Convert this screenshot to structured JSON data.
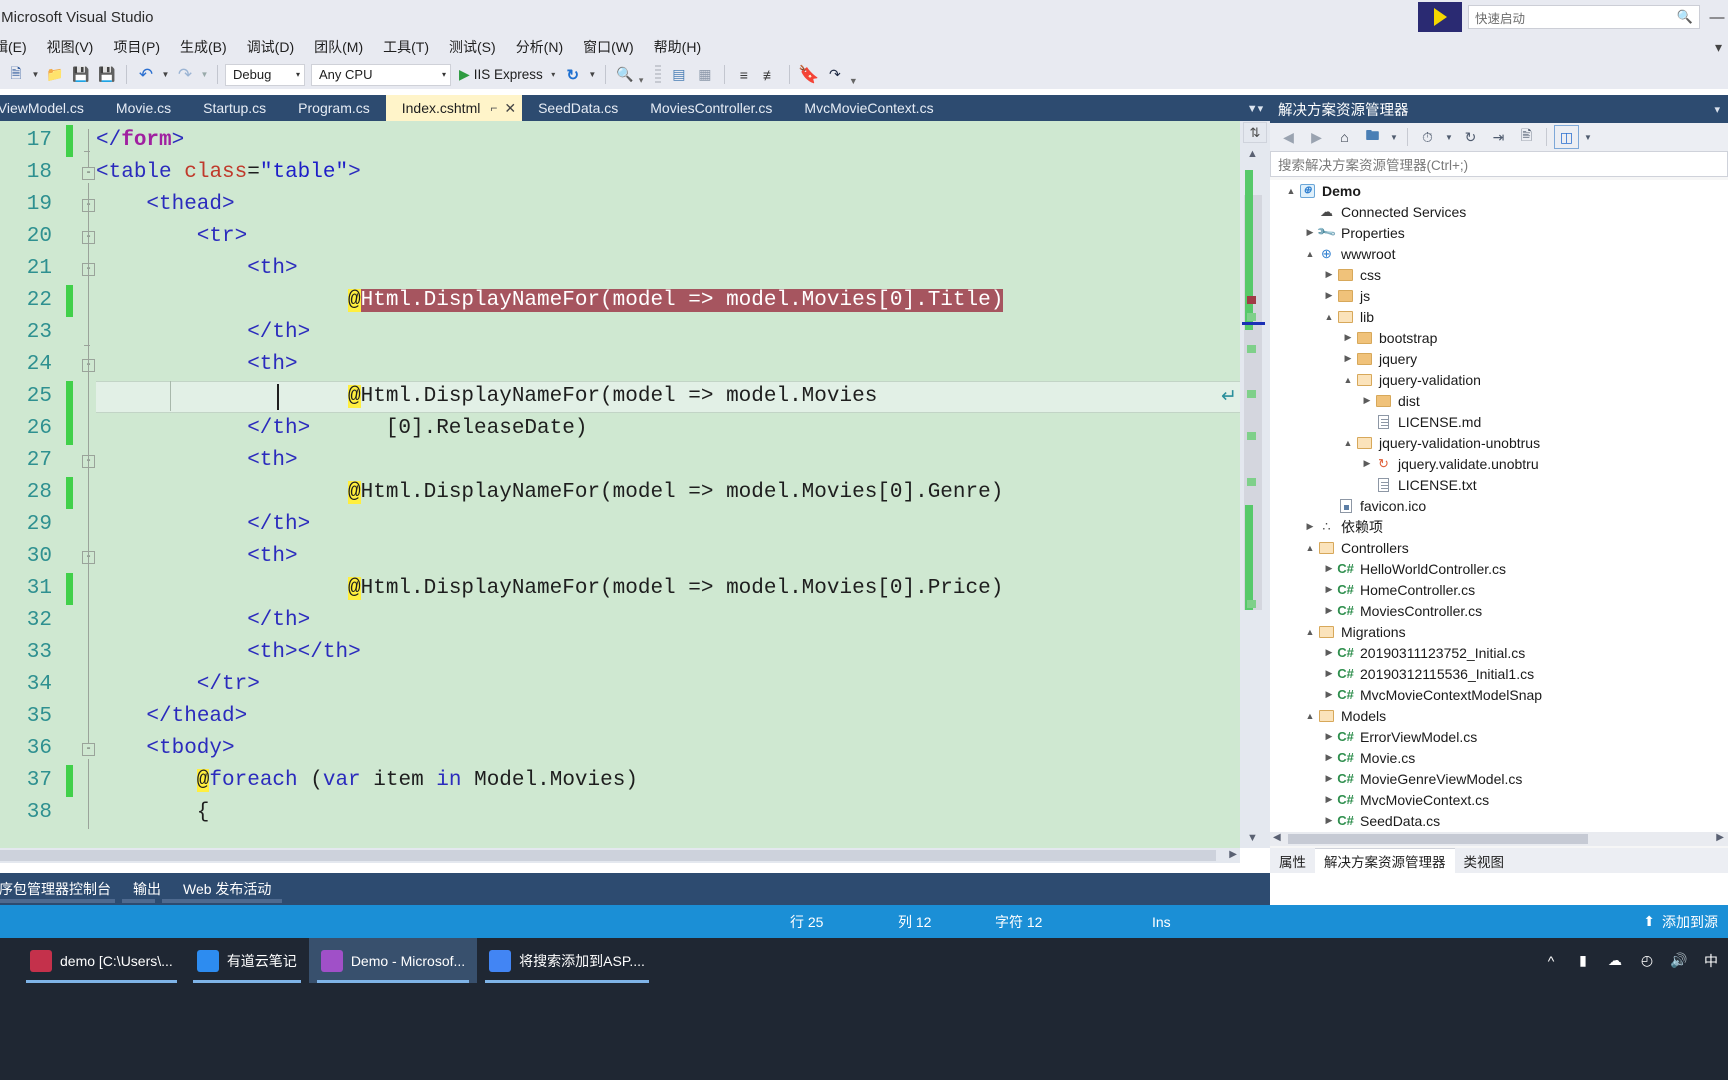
{
  "titlebar": {
    "title": "- Microsoft Visual Studio",
    "quick_launch_placeholder": "快速启动",
    "quick_launch_icon": "magnifier-icon",
    "flag_icon": "vs-flag-icon",
    "minimize": "—"
  },
  "menu": {
    "items": [
      "辑(E)",
      "视图(V)",
      "项目(P)",
      "生成(B)",
      "调试(D)",
      "团队(M)",
      "工具(T)",
      "测试(S)",
      "分析(N)",
      "窗口(W)",
      "帮助(H)"
    ],
    "overflow": "▾"
  },
  "toolbar": {
    "new_project_icon": "new-project-icon",
    "open_icon": "open-folder-icon",
    "save_icon": "save-icon",
    "save_all_icon": "save-all-icon",
    "undo_icon": "undo-icon",
    "redo_icon": "redo-icon",
    "config": {
      "value": "Debug",
      "caret": "▾"
    },
    "platform": {
      "value": "Any CPU",
      "caret": "▾"
    },
    "run": {
      "play": "▶",
      "label": "IIS Express",
      "caret": "▾"
    },
    "refresh_icon": "refresh-icon",
    "find_icon": "find-icon",
    "comment_icon": "comment-icon",
    "uncomment_icon": "uncomment-icon",
    "indent_icon": "indent-icon",
    "outdent_icon": "outdent-icon",
    "bookmark_icon": "bookmark-icon",
    "next_bookmark_icon": "next-bookmark-icon",
    "overflow_caret": "▾"
  },
  "tabs": {
    "items": [
      {
        "label": "eViewModel.cs",
        "active": false
      },
      {
        "label": "Movie.cs",
        "active": false
      },
      {
        "label": "Startup.cs",
        "active": false
      },
      {
        "label": "Program.cs",
        "active": false
      },
      {
        "label": "Index.cshtml",
        "active": true,
        "pin": "⌐",
        "close": "✕"
      },
      {
        "label": "SeedData.cs",
        "active": false
      },
      {
        "label": "MoviesController.cs",
        "active": false
      },
      {
        "label": "MvcMovieContext.cs",
        "active": false
      }
    ],
    "overflow_icon": "tab-overflow-icon"
  },
  "editor": {
    "lines": [
      {
        "num": "17",
        "changed": true,
        "fold": null,
        "indent": 0
      },
      {
        "num": "18",
        "changed": false,
        "fold": "-",
        "indent": 0
      },
      {
        "num": "19",
        "changed": false,
        "fold": "-",
        "indent": 1
      },
      {
        "num": "20",
        "changed": false,
        "fold": "-",
        "indent": 1
      },
      {
        "num": "21",
        "changed": false,
        "fold": "-",
        "indent": 1
      },
      {
        "num": "22",
        "changed": true,
        "fold": null,
        "indent": 1
      },
      {
        "num": "23",
        "changed": false,
        "fold": null,
        "indent": 1
      },
      {
        "num": "24",
        "changed": false,
        "fold": "-",
        "indent": 1
      },
      {
        "num": "25",
        "changed": true,
        "fold": null,
        "indent": 1
      },
      {
        "num": "26",
        "changed": true,
        "fold": null,
        "indent": 1
      },
      {
        "num": "27",
        "changed": false,
        "fold": "-",
        "indent": 1
      },
      {
        "num": "28",
        "changed": true,
        "fold": null,
        "indent": 1
      },
      {
        "num": "29",
        "changed": false,
        "fold": null,
        "indent": 1
      },
      {
        "num": "30",
        "changed": false,
        "fold": "-",
        "indent": 1
      },
      {
        "num": "31",
        "changed": true,
        "fold": null,
        "indent": 1
      },
      {
        "num": "32",
        "changed": false,
        "fold": null,
        "indent": 1
      },
      {
        "num": "33",
        "changed": false,
        "fold": null,
        "indent": 1
      },
      {
        "num": "34",
        "changed": false,
        "fold": null,
        "indent": 1
      },
      {
        "num": "35",
        "changed": false,
        "fold": null,
        "indent": 0
      },
      {
        "num": "36",
        "changed": false,
        "fold": "-",
        "indent": 0
      },
      {
        "num": "37",
        "changed": true,
        "fold": null,
        "indent": 1
      },
      {
        "num": "38",
        "changed": false,
        "fold": null,
        "indent": 1
      }
    ],
    "code_text": {
      "l17": "</form>",
      "l18": "<table class=\"table\">",
      "l19": "<thead>",
      "l20": "<tr>",
      "l21": "<th>",
      "l22": "@Html.DisplayNameFor(model => model.Movies[0].Title)",
      "l23": "</th>",
      "l24": "<th>",
      "l25a": "@Html.DisplayNameFor(model => model.Movies",
      "l25b": "[0].ReleaseDate)",
      "l26": "</th>",
      "l27": "<th>",
      "l28": "@Html.DisplayNameFor(model => model.Movies[0].Genre)",
      "l29": "</th>",
      "l30": "<th>",
      "l31": "@Html.DisplayNameFor(model => model.Movies[0].Price)",
      "l32": "</th>",
      "l33": "<th></th>",
      "l34": "</tr>",
      "l35": "</thead>",
      "l36": "<tbody>",
      "l37": "@foreach (var item in Model.Movies)",
      "l38": "{"
    },
    "wrap_glyph": "↵",
    "colors": {
      "background": "#cfe8d1",
      "line_number": "#2e9090",
      "change_bar": "#41d04a",
      "selection": "#a6555f",
      "razor_at": "#ffef3f",
      "current_line": "#e2f0e6"
    },
    "scroll": {
      "split_icon": "split-view-icon",
      "up_arrow": "▲",
      "down_arrow": "▼",
      "h_right_arrow": "▶"
    }
  },
  "solution_explorer": {
    "title": "解决方案资源管理器",
    "title_caret": "▾",
    "search_placeholder": "搜索解决方案资源管理器(Ctrl+;)",
    "toolbar_icons": [
      "back-icon",
      "forward-icon",
      "home-icon",
      "new-folder-icon",
      "caret-down-icon",
      "pending-changes-icon",
      "caret-down-icon",
      "refresh-icon",
      "collapse-all-icon",
      "properties-icon",
      "show-all-files-icon",
      "caret-down-icon"
    ],
    "tree": [
      {
        "label": "Demo",
        "depth": 0,
        "expander": "▲",
        "icon": "project-icon",
        "bold": true
      },
      {
        "label": "Connected Services",
        "depth": 1,
        "expander": "",
        "icon": "cloud-icon"
      },
      {
        "label": "Properties",
        "depth": 1,
        "expander": "▶",
        "icon": "wrench-icon"
      },
      {
        "label": "wwwroot",
        "depth": 1,
        "expander": "▲",
        "icon": "globe-icon"
      },
      {
        "label": "css",
        "depth": 2,
        "expander": "▶",
        "icon": "folder-icon"
      },
      {
        "label": "js",
        "depth": 2,
        "expander": "▶",
        "icon": "folder-icon"
      },
      {
        "label": "lib",
        "depth": 2,
        "expander": "▲",
        "icon": "folder-open-icon"
      },
      {
        "label": "bootstrap",
        "depth": 3,
        "expander": "▶",
        "icon": "folder-icon"
      },
      {
        "label": "jquery",
        "depth": 3,
        "expander": "▶",
        "icon": "folder-icon"
      },
      {
        "label": "jquery-validation",
        "depth": 3,
        "expander": "▲",
        "icon": "folder-open-icon"
      },
      {
        "label": "dist",
        "depth": 4,
        "expander": "▶",
        "icon": "folder-icon"
      },
      {
        "label": "LICENSE.md",
        "depth": 4,
        "expander": "",
        "icon": "document-icon"
      },
      {
        "label": "jquery-validation-unobtrus",
        "depth": 3,
        "expander": "▲",
        "icon": "folder-open-icon"
      },
      {
        "label": "jquery.validate.unobtru",
        "depth": 4,
        "expander": "▶",
        "icon": "jquery-icon"
      },
      {
        "label": "LICENSE.txt",
        "depth": 4,
        "expander": "",
        "icon": "document-icon"
      },
      {
        "label": "favicon.ico",
        "depth": 2,
        "expander": "",
        "icon": "ico-file-icon"
      },
      {
        "label": "依赖项",
        "depth": 1,
        "expander": "▶",
        "icon": "dependencies-icon"
      },
      {
        "label": "Controllers",
        "depth": 1,
        "expander": "▲",
        "icon": "folder-open-icon"
      },
      {
        "label": "HelloWorldController.cs",
        "depth": 2,
        "expander": "▶",
        "icon": "csharp-icon"
      },
      {
        "label": "HomeController.cs",
        "depth": 2,
        "expander": "▶",
        "icon": "csharp-icon"
      },
      {
        "label": "MoviesController.cs",
        "depth": 2,
        "expander": "▶",
        "icon": "csharp-icon"
      },
      {
        "label": "Migrations",
        "depth": 1,
        "expander": "▲",
        "icon": "folder-open-icon"
      },
      {
        "label": "20190311123752_Initial.cs",
        "depth": 2,
        "expander": "▶",
        "icon": "csharp-icon"
      },
      {
        "label": "20190312115536_Initial1.cs",
        "depth": 2,
        "expander": "▶",
        "icon": "csharp-icon"
      },
      {
        "label": "MvcMovieContextModelSnap",
        "depth": 2,
        "expander": "▶",
        "icon": "csharp-icon"
      },
      {
        "label": "Models",
        "depth": 1,
        "expander": "▲",
        "icon": "folder-open-icon"
      },
      {
        "label": "ErrorViewModel.cs",
        "depth": 2,
        "expander": "▶",
        "icon": "csharp-icon"
      },
      {
        "label": "Movie.cs",
        "depth": 2,
        "expander": "▶",
        "icon": "csharp-icon"
      },
      {
        "label": "MovieGenreViewModel.cs",
        "depth": 2,
        "expander": "▶",
        "icon": "csharp-icon"
      },
      {
        "label": "MvcMovieContext.cs",
        "depth": 2,
        "expander": "▶",
        "icon": "csharp-icon"
      },
      {
        "label": "SeedData.cs",
        "depth": 2,
        "expander": "▶",
        "icon": "csharp-icon"
      }
    ],
    "bottom_tabs": [
      {
        "label": "属性",
        "active": false
      },
      {
        "label": "解决方案资源管理器",
        "active": true
      },
      {
        "label": "类视图",
        "active": false
      }
    ],
    "hscroll_left": "◀",
    "hscroll_right": "▶"
  },
  "bottom_panel": {
    "tabs": [
      "序包管理器控制台",
      "输出",
      "Web 发布活动"
    ]
  },
  "statusbar": {
    "row_label": "行 25",
    "col_label": "列 12",
    "char_label": "字符 12",
    "ins_label": "Ins",
    "publish_label": "添加到源",
    "publish_icon": "upload-icon"
  },
  "taskbar": {
    "items": [
      {
        "label": "demo [C:\\Users\\...",
        "icon": "intellij-icon",
        "color": "#c4314b",
        "active": false
      },
      {
        "label": "有道云笔记",
        "icon": "youdao-icon",
        "color": "#2d8cf0",
        "active": false
      },
      {
        "label": "Demo - Microsof...",
        "icon": "visual-studio-icon",
        "color": "#a050c8",
        "active": true
      },
      {
        "label": "将搜索添加到ASP....",
        "icon": "chrome-icon",
        "color": "#4285f4",
        "active": false
      }
    ],
    "tray": [
      "^",
      "battery-icon",
      "onedrive-icon",
      "network-icon",
      "volume-icon",
      "中"
    ]
  }
}
